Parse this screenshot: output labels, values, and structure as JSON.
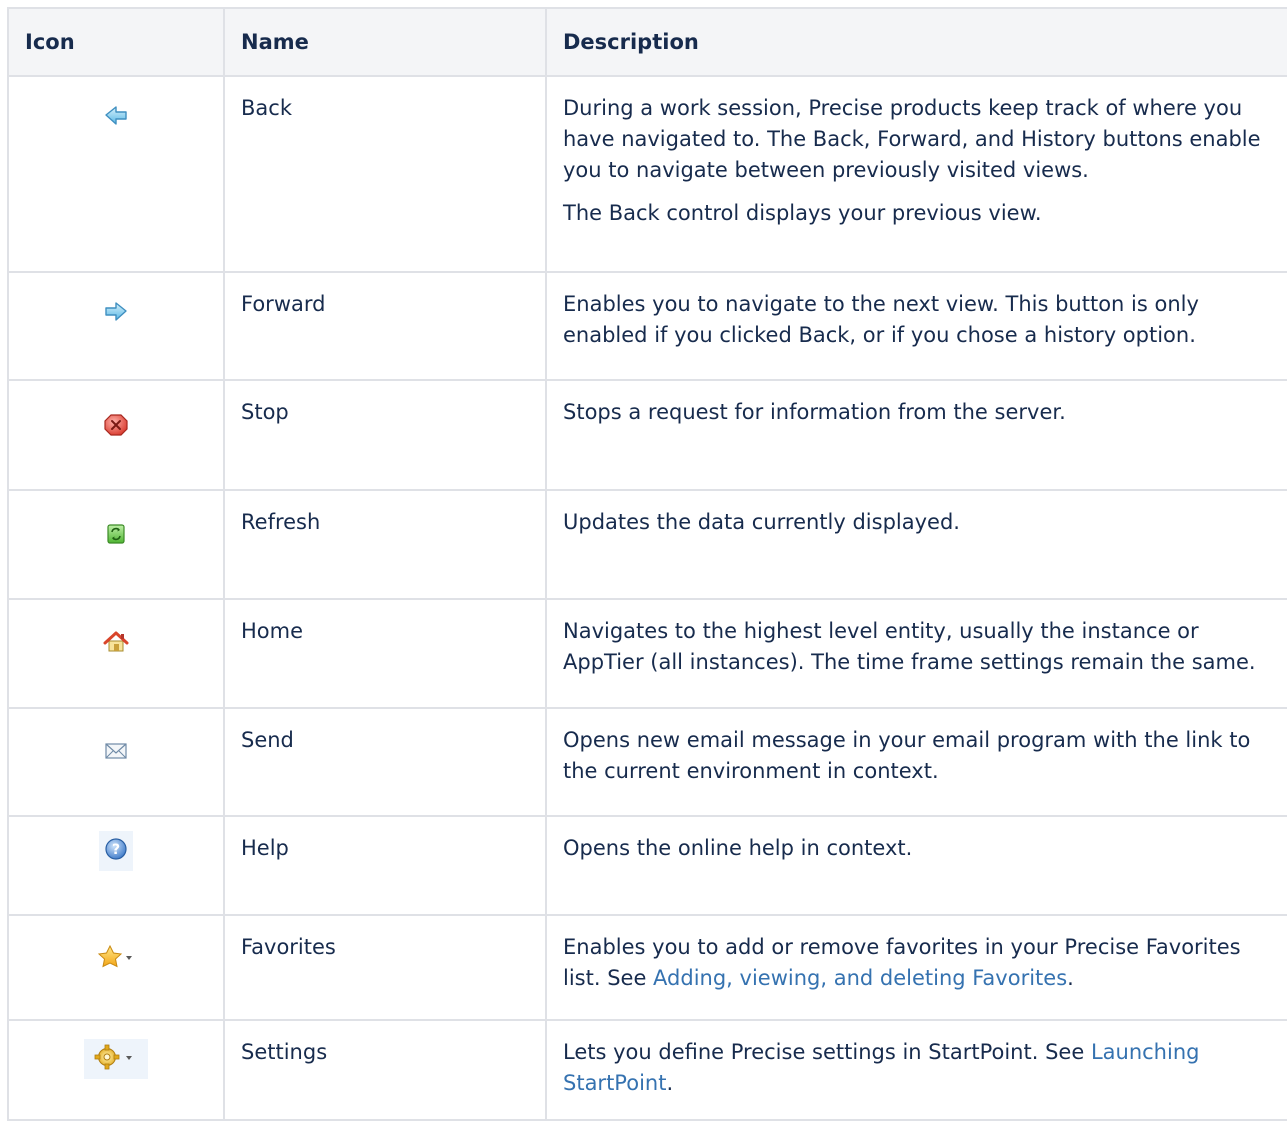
{
  "table": {
    "headers": {
      "icon": "Icon",
      "name": "Name",
      "description": "Description"
    },
    "rows": [
      {
        "icon": "back-arrow-icon",
        "name": "Back",
        "description": [
          "During a work session, Precise products keep track of where you have navigated to. The Back, Forward, and History buttons enable you to navigate between previously visited views.",
          "The Back control displays your previous view."
        ]
      },
      {
        "icon": "forward-arrow-icon",
        "name": "Forward",
        "description": [
          "Enables you to navigate to the next view. This button is only enabled if you clicked Back, or if you chose a history option."
        ]
      },
      {
        "icon": "stop-icon",
        "name": "Stop",
        "description": [
          "Stops a request for information from the server."
        ]
      },
      {
        "icon": "refresh-icon",
        "name": "Refresh",
        "description": [
          "Updates the data currently displayed."
        ]
      },
      {
        "icon": "home-icon",
        "name": "Home",
        "description": [
          "Navigates to the highest level entity, usually the instance or AppTier (all instances). The time frame settings remain the same."
        ]
      },
      {
        "icon": "envelope-icon",
        "name": "Send",
        "description": [
          "Opens new email message in your email program with the link to the current environment in context."
        ]
      },
      {
        "icon": "help-icon",
        "name": "Help",
        "description": [
          "Opens the online help in context."
        ]
      },
      {
        "icon": "star-dropdown-icon",
        "name": "Favorites",
        "description_prefix": "Enables you to add or remove favorites in your Precise Favorites list. See ",
        "description_link": "Adding, viewing, and deleting Favorites",
        "description_suffix": "."
      },
      {
        "icon": "gear-dropdown-icon",
        "name": "Settings",
        "description_prefix": "Lets you define Precise settings in StartPoint. See ",
        "description_link": "Launching StartPoint",
        "description_suffix": "."
      }
    ]
  },
  "colors": {
    "link": "#3572b0",
    "header_bg": "#f4f5f7",
    "border": "#dfe1e6",
    "text": "#172b4d"
  }
}
